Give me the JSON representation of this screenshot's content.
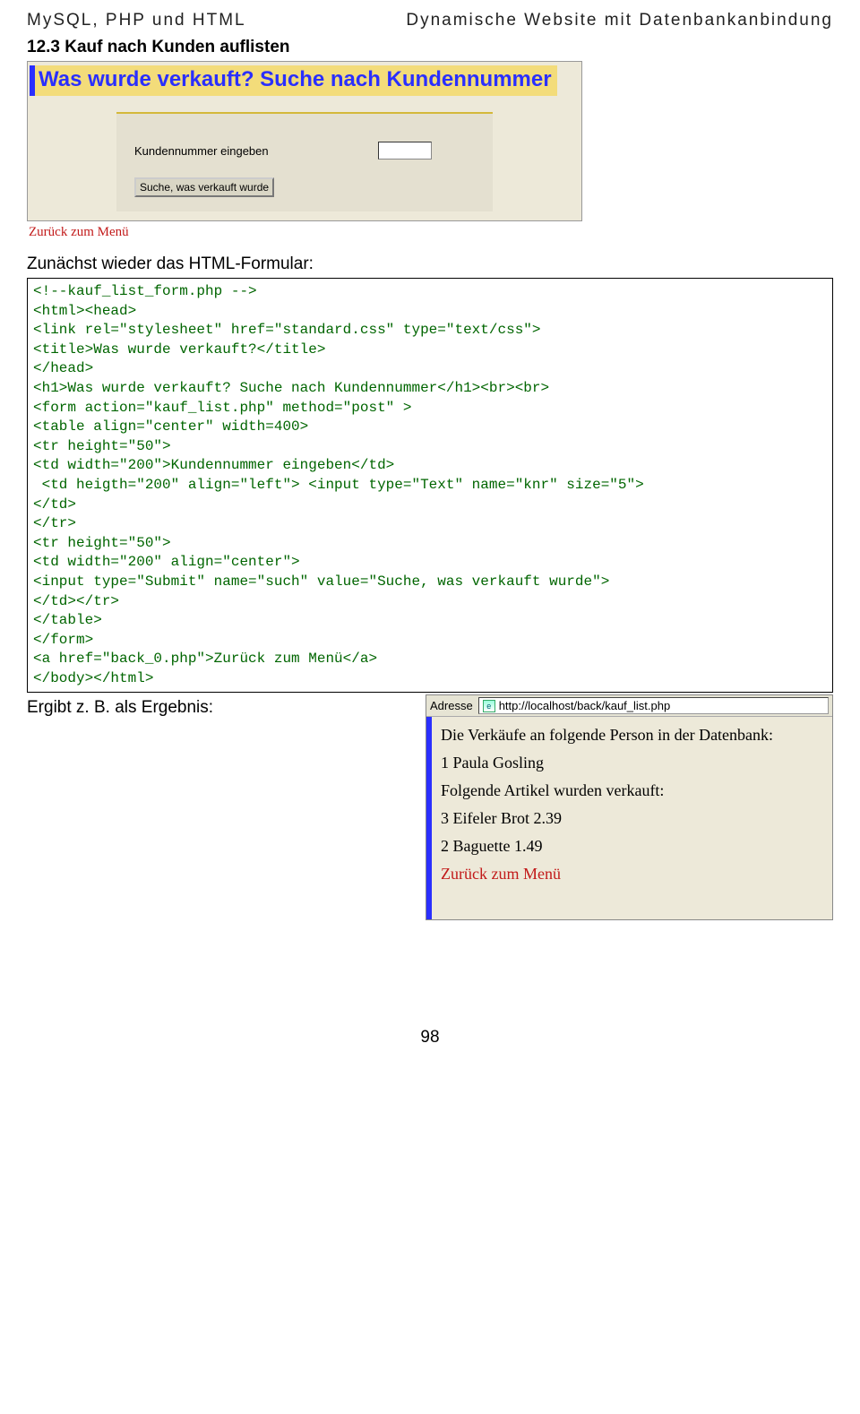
{
  "header": {
    "left": "MySQL, PHP und HTML",
    "right": "Dynamische Website mit Datenbankanbindung"
  },
  "section": {
    "heading": "12.3   Kauf nach Kunden auflisten"
  },
  "form1": {
    "h1": "Was wurde verkauft? Suche nach Kundennummer",
    "labelKnr": "Kundennummer eingeben",
    "submit": "Suche, was verkauft wurde",
    "back": "Zurück zum Menü"
  },
  "intro": "Zunächst wieder das HTML-Formular:",
  "code": "<!--kauf_list_form.php -->\n<html><head>\n<link rel=\"stylesheet\" href=\"standard.css\" type=\"text/css\">\n<title>Was wurde verkauft?</title>\n</head>\n<h1>Was wurde verkauft? Suche nach Kundennummer</h1><br><br>\n<form action=\"kauf_list.php\" method=\"post\" >\n<table align=\"center\" width=400>\n<tr height=\"50\">\n<td width=\"200\">Kundennummer eingeben</td>\n <td heigth=\"200\" align=\"left\"> <input type=\"Text\" name=\"knr\" size=\"5\">\n</td>\n</tr>\n<tr height=\"50\">\n<td width=\"200\" align=\"center\">\n<input type=\"Submit\" name=\"such\" value=\"Suche, was verkauft wurde\">\n</td></tr>\n</table>\n</form>\n<a href=\"back_0.php\">Zurück zum Menü</a>\n</body></html>",
  "resultLabel": "Ergibt z. B. als Ergebnis:",
  "result": {
    "addrLabel": "Adresse",
    "url": "http://localhost/back/kauf_list.php",
    "lines": {
      "top": "Die Verkäufe an folgende Person in der Datenbank:",
      "l1": "1 Paula Gosling",
      "l2": "Folgende Artikel wurden verkauft:",
      "l3": "3 Eifeler Brot 2.39",
      "l4": "2 Baguette 1.49",
      "back": "Zurück zum Menü"
    }
  },
  "pageNum": "98"
}
